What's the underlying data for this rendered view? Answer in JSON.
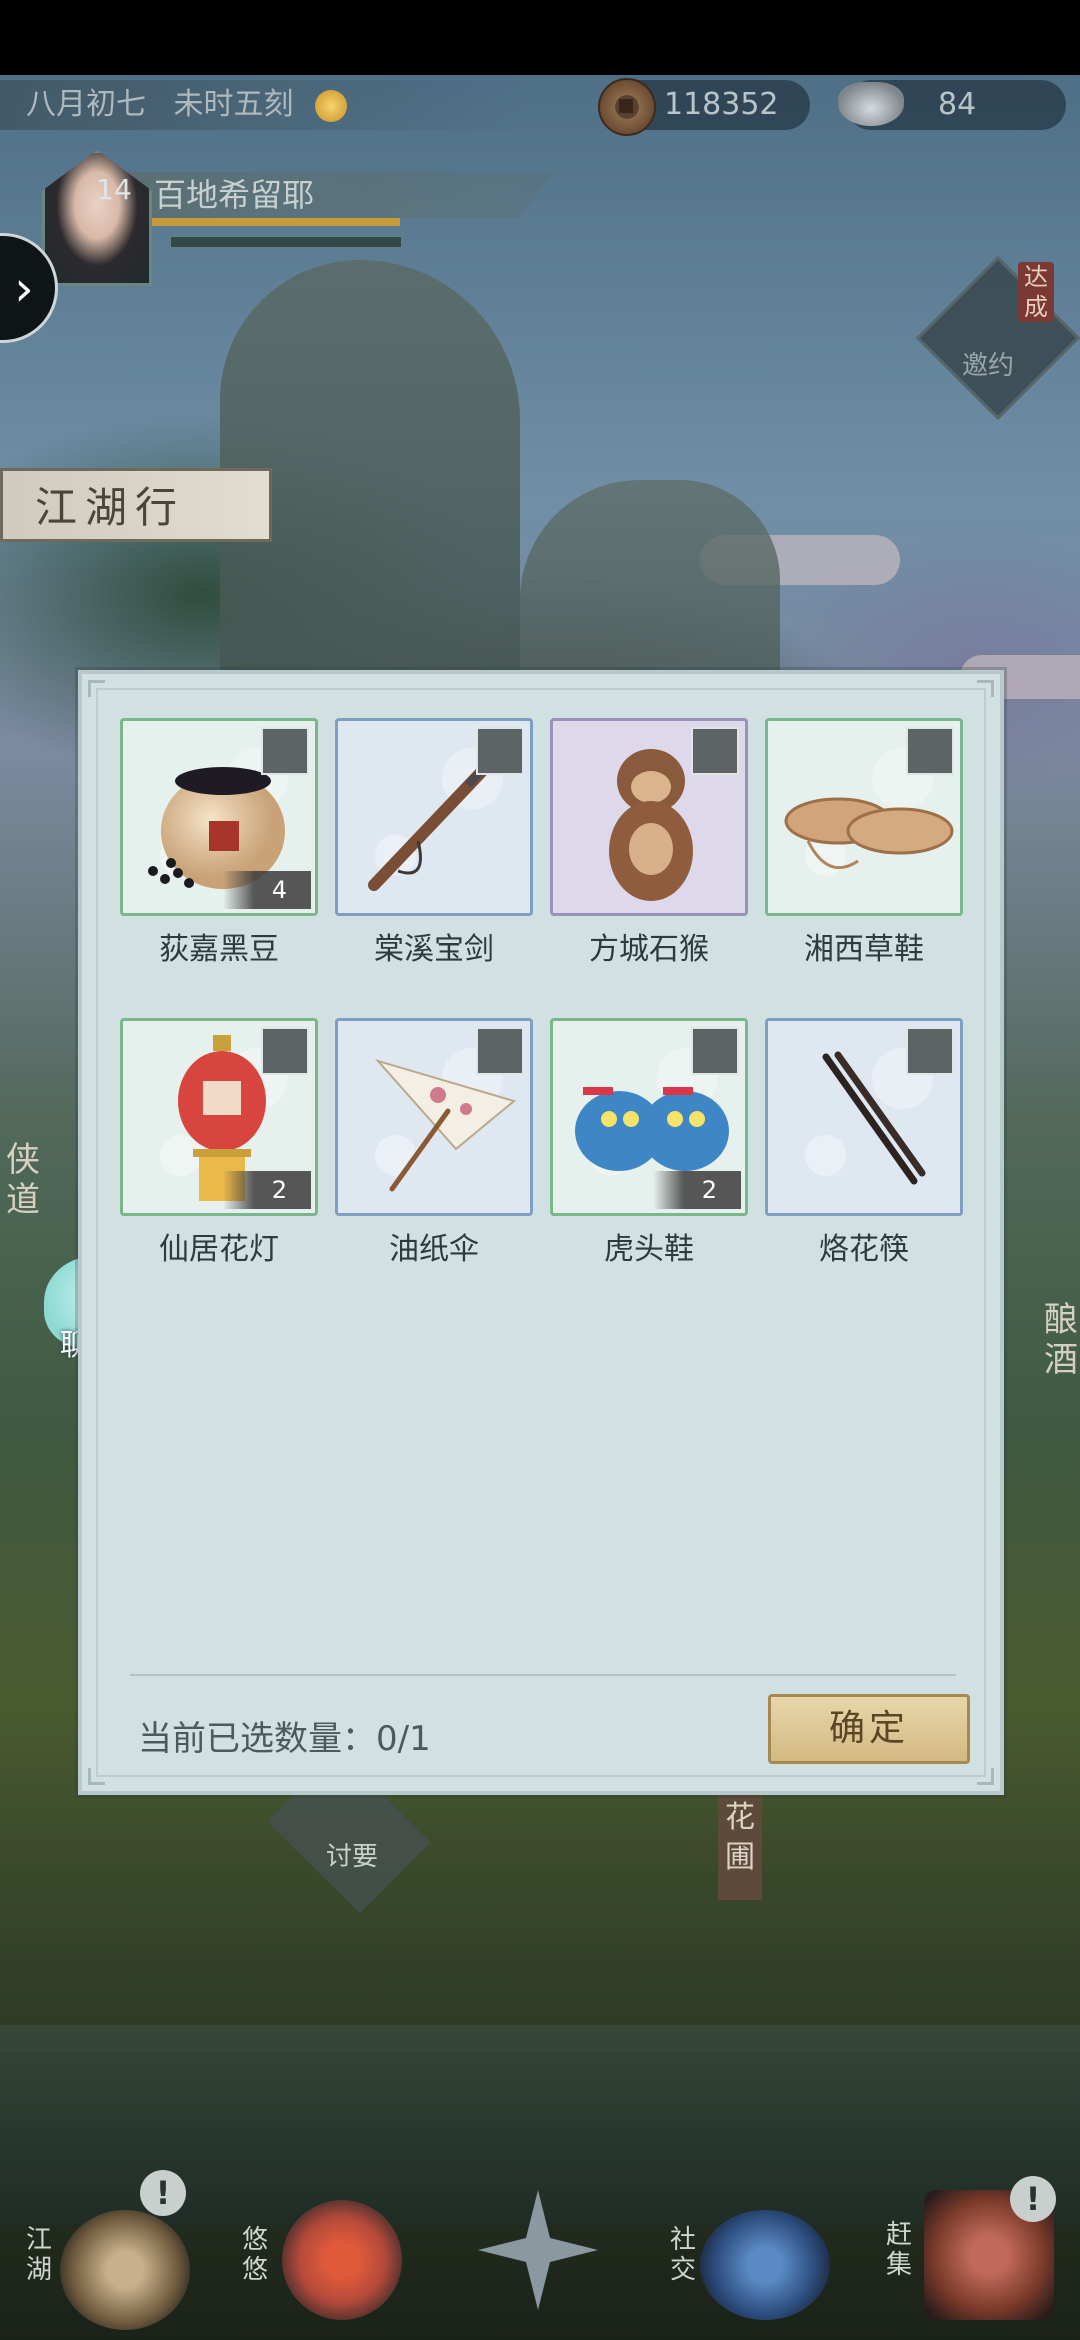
{
  "hud": {
    "date": "八月初七",
    "time": "未时五刻",
    "coins": "118352",
    "silver": "84",
    "player_level": "14",
    "player_name": "百地希留耶",
    "invite_label": "邀约",
    "achieve_label": "达成",
    "location_sign": "江湖行",
    "side_left_label": "侠道",
    "side_right_label": "酿酒",
    "chat_label": "聊天",
    "beg_label": "讨要",
    "garden_label": "花圃"
  },
  "dialog": {
    "items": [
      {
        "name": "荻嘉黑豆",
        "count": "4",
        "icon": "black-bean-jar-icon"
      },
      {
        "name": "棠溪宝剑",
        "count": "",
        "icon": "sword-icon"
      },
      {
        "name": "方城石猴",
        "count": "",
        "icon": "stone-monkey-icon"
      },
      {
        "name": "湘西草鞋",
        "count": "",
        "icon": "straw-sandals-icon"
      },
      {
        "name": "仙居花灯",
        "count": "2",
        "icon": "flower-lantern-icon"
      },
      {
        "name": "油纸伞",
        "count": "",
        "icon": "paper-umbrella-icon"
      },
      {
        "name": "虎头鞋",
        "count": "2",
        "icon": "tiger-head-shoes-icon"
      },
      {
        "name": "烙花筷",
        "count": "",
        "icon": "chopsticks-icon"
      }
    ],
    "selected_label": "当前已选数量：0/1",
    "confirm_label": "确定"
  },
  "bottom_nav": {
    "jianghu": "江湖",
    "youyou": "悠悠",
    "social": "社交",
    "market": "赶集"
  },
  "colors": {
    "dialog_bg": "#d1e0e1",
    "slot_green": "#7ab88b",
    "slot_blue": "#7f9ec4",
    "slot_purple": "#9a92b8",
    "confirm_gold": "#d3b983"
  }
}
